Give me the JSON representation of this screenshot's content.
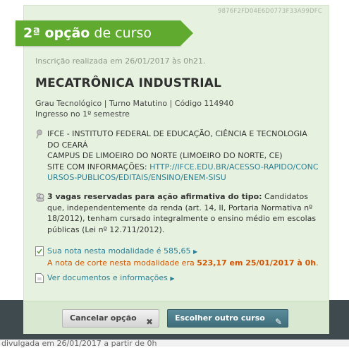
{
  "card_code": "9876F2FD04E6D0773F33A99DFC",
  "ribbon": {
    "prefix": "2ª opção",
    "suffix": " de curso"
  },
  "inscricao": "Inscrição realizada em 26/01/2017 às 0h21.",
  "course": {
    "title": "MECATRÔNICA INDUSTRIAL",
    "details": "Grau Tecnológico | Turno Matutino | Código 114940",
    "ingresso": "Ingresso no 1º semestre"
  },
  "institution": {
    "name": "IFCE - INSTITUTO FEDERAL DE EDUCAÇÃO, CIÊNCIA E TECNOLOGIA DO CEARÁ",
    "campus": "CAMPUS DE LIMOEIRO DO NORTE (LIMOEIRO DO NORTE, CE)",
    "site_label": "SITE COM INFORMAÇÕES: ",
    "site_url": "HTTP://IFCE.EDU.BR/ACESSO-RAPIDO/CONCURSOS-PUBLICOS/EDITAIS/ENSINO/ENEM-SISU"
  },
  "vagas": {
    "bold": "3 vagas reservadas para ação afirmativa do tipo:",
    "text": " Candidatos que, independentemente da renda (art. 14, II, Portaria Normativa nº 18/2012), tenham cursado integralmente o ensino médio em escolas públicas (Lei nº 12.711/2012)."
  },
  "nota": {
    "sua_nota": "Sua nota nesta modalidade é 585,65",
    "corte_prefix": "A nota de corte nesta modalidade era ",
    "corte_value": "523,17 em 25/01/2017 à 0h",
    "corte_suffix": "."
  },
  "docs_link": "Ver documentos e informações",
  "buttons": {
    "cancel": "Cancelar opção",
    "other": "Escolher outro curso"
  },
  "background_text": "divulgada em 26/01/2017 a partir de 0h"
}
